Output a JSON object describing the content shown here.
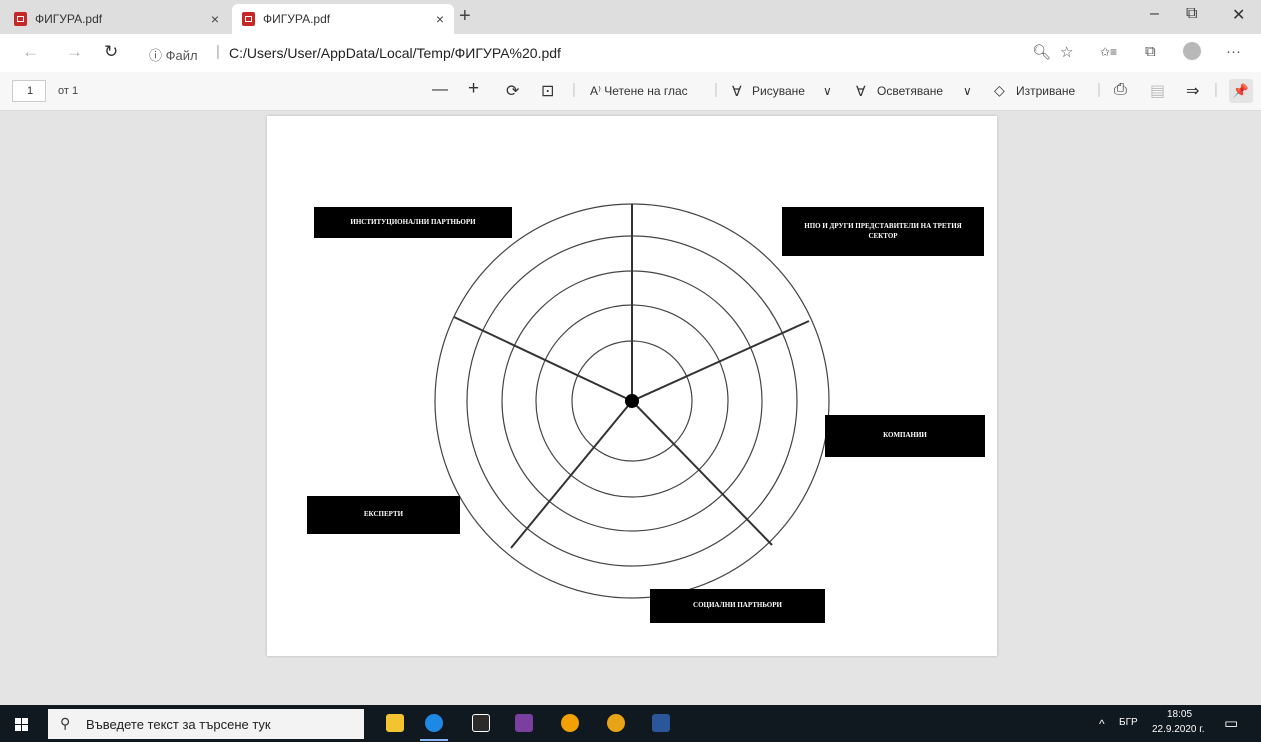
{
  "browser": {
    "tabs": [
      {
        "title": "ФИГУРА.pdf",
        "close": "×",
        "active": false
      },
      {
        "title": "ФИГУРА.pdf",
        "close": "×",
        "active": true
      }
    ],
    "new_tab": "+",
    "window_controls": {
      "minimize": "–",
      "restore": "⧉",
      "close": "✕"
    },
    "nav": {
      "back": "←",
      "forward": "→",
      "reload": "↻"
    },
    "address": {
      "info_label": "ⓘ Файл",
      "separator": "|",
      "url": "C:/Users/User/AppData/Local/Temp/ФИГУРА%20.pdf"
    },
    "address_icons": {
      "zoom": "🔍︎",
      "favorite": "☆",
      "favorites": "✩≡",
      "collections": "⧉",
      "more": "···"
    }
  },
  "pdf_toolbar": {
    "page_number": "1",
    "page_total": "от 1",
    "zoom_out": "—",
    "zoom_in": "+",
    "rotate": "⟳",
    "fit": "⊡",
    "read_aloud": "A⁾ Четене на глас",
    "draw": "Рисуване",
    "highlight": "Осветяване",
    "erase": "Изтриване",
    "chevron": "∨",
    "print": "⎙",
    "save": "▤",
    "save_as": "⇒",
    "pin": "📌"
  },
  "document": {
    "labels": {
      "institutional": "ИНСТИТУЦИОНАЛНИ ПАРТНЬОРИ",
      "ngo": "НПО И ДРУГИ ПРЕДСТАВИТЕЛИ НА ТРЕТИЯ СЕКТОР",
      "companies": "КОМПАНИИ",
      "experts": "ЕКСПЕРТИ",
      "social": "СОЦИАЛНИ ПАРТНЬОРИ"
    }
  },
  "taskbar": {
    "search_placeholder": "Въведете текст за търсене тук",
    "tray_chevron": "^",
    "language": "БГР",
    "time": "18:05",
    "date": "22.9.2020 г.",
    "notification": "▭",
    "colors": {
      "explorer": "#f4c430",
      "edge": "#1e88e5",
      "store": "#2b2b2b",
      "winrar": "#7b3fa0",
      "chrome": "#f2a100",
      "vpn": "#e8a317",
      "word": "#2b579a"
    }
  }
}
